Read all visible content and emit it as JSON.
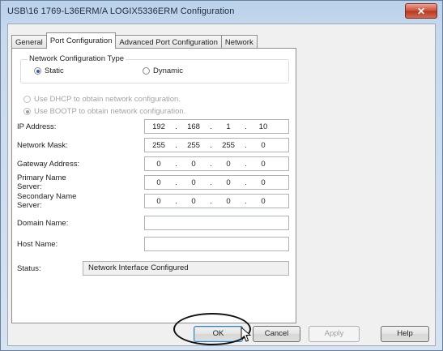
{
  "window": {
    "title": "USB\\16 1769-L36ERM/A LOGIX5336ERM Configuration",
    "close_label": "✕"
  },
  "tabs": [
    {
      "label": "General"
    },
    {
      "label": "Port Configuration"
    },
    {
      "label": "Advanced Port Configuration"
    },
    {
      "label": "Network"
    }
  ],
  "network_config": {
    "group_label": "Network Configuration Type",
    "static_label": "Static",
    "dynamic_label": "Dynamic",
    "selected": "Static",
    "dhcp_label": "Use DHCP to obtain network configuration.",
    "bootp_label": "Use BOOTP to obtain network configuration.",
    "bootp_selected": true
  },
  "fields": {
    "ip_label": "IP Address:",
    "ip": [
      "192",
      "168",
      "1",
      "10"
    ],
    "mask_label": "Network Mask:",
    "mask": [
      "255",
      "255",
      "255",
      "0"
    ],
    "gateway_label": "Gateway Address:",
    "gateway": [
      "0",
      "0",
      "0",
      "0"
    ],
    "primary_label_1": "Primary Name",
    "primary_label_2": "Server:",
    "primary": [
      "0",
      "0",
      "0",
      "0"
    ],
    "secondary_label_1": "Secondary Name",
    "secondary_label_2": "Server:",
    "secondary": [
      "0",
      "0",
      "0",
      "0"
    ],
    "domain_label": "Domain Name:",
    "domain_value": "",
    "host_label": "Host Name:",
    "host_value": ""
  },
  "status": {
    "label": "Status:",
    "value": "Network Interface Configured"
  },
  "buttons": {
    "ok": "OK",
    "cancel": "Cancel",
    "apply": "Apply",
    "help": "Help"
  },
  "icons": {
    "close": "close-icon",
    "cursor": "mouse-pointer-icon"
  }
}
